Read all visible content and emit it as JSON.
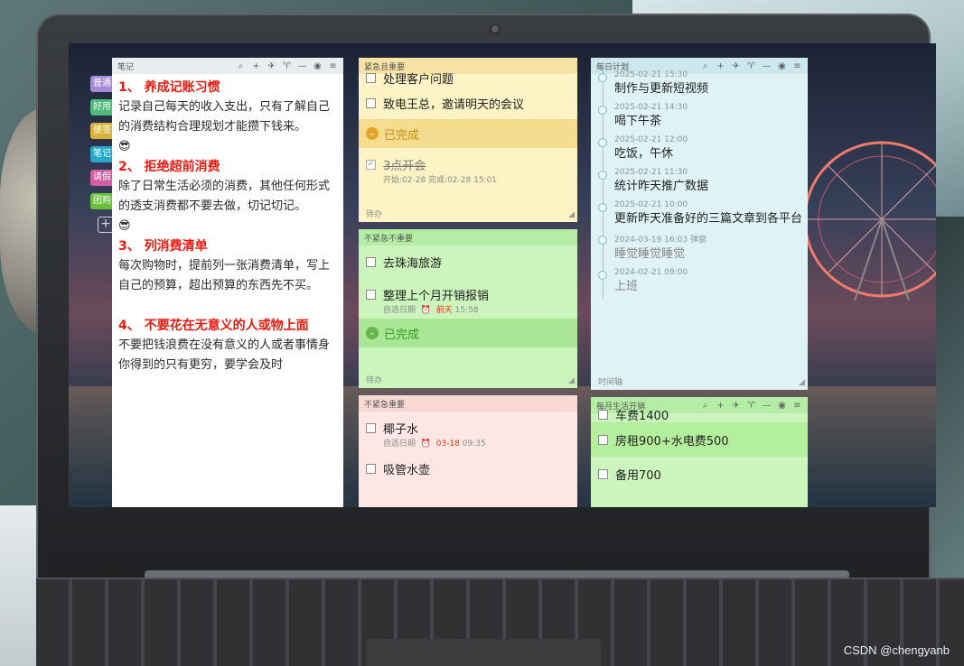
{
  "watermark": "CSDN @chengyanb",
  "side_tabs": [
    {
      "label": "普通",
      "color": "#a58bd9"
    },
    {
      "label": "好用",
      "color": "#4fb87a"
    },
    {
      "label": "便签",
      "color": "#d9b23b"
    },
    {
      "label": "笔记",
      "color": "#2aa7c9"
    },
    {
      "label": "请假",
      "color": "#d15ea3"
    },
    {
      "label": "团购",
      "color": "#6abf3b"
    }
  ],
  "main_note": {
    "title": "笔记",
    "sections": [
      {
        "title": "1、 养成记账习惯",
        "body": "记录自己每天的收入支出，只有了解自己的消费结构合理规划才能攒下钱来。",
        "emoji": "😎"
      },
      {
        "title": "2、 拒绝超前消费",
        "body": "除了日常生活必须的消费，其他任何形式的透支消费都不要去做，切记切记。",
        "emoji": "😎"
      },
      {
        "title": "3、 列消费清单",
        "body": "每次购物时，提前列一张消费清单，写上自己的预算，超出预算的东西先不买。"
      },
      {
        "title": "4、 不要花在无意义的人或物上面",
        "body": "不要把钱浪费在没有意义的人或者事情身你得到的只有更穷，要学会及时"
      }
    ]
  },
  "q1": {
    "title": "紧急且重要",
    "cut_task": "处理客户问题",
    "task": "致电王总，邀请明天的会议",
    "done_label": "已完成",
    "done_task": "3点开会",
    "done_meta": "开始:02-28    完成:02-28 15:01",
    "footer": "待办"
  },
  "q2": {
    "title": "不紧急不重要",
    "tasks": [
      {
        "text": "去珠海旅游"
      },
      {
        "text": "整理上个月开销报销",
        "meta_a": "自选日期",
        "meta_b": "前天",
        "meta_c": "15:58"
      }
    ],
    "done_label": "已完成",
    "footer": "待办"
  },
  "q3": {
    "title": "不紧急重要",
    "tasks": [
      {
        "text": "椰子水",
        "meta_a": "自选日期",
        "meta_b": "03-18",
        "meta_c": "09:35"
      },
      {
        "text": "吸管水壶"
      }
    ]
  },
  "timeline": {
    "title": "每日计划",
    "items": [
      {
        "time": "2025-02-21 15:30",
        "text": "制作与更新短视频"
      },
      {
        "time": "2025-02-21 14:30",
        "text": "喝下午茶"
      },
      {
        "time": "2025-02-21 12:00",
        "text": "吃饭，午休"
      },
      {
        "time": "2025-02-21 11:30",
        "text": "统计昨天推广数据"
      },
      {
        "time": "2025-02-21 10:00",
        "text": "更新昨天准备好的三篇文章到各平台"
      },
      {
        "time": "2024-03-19 16:03  弹窗",
        "text": "睡觉睡觉睡觉",
        "done": true
      },
      {
        "time": "2024-02-21 09:00",
        "text": "上班",
        "done": true
      }
    ],
    "footer": "时间轴"
  },
  "monthly": {
    "title": "每月生活开销",
    "rows": [
      {
        "text": "车费1400"
      },
      {
        "text": "房租900+水电费500"
      },
      {
        "text": "备用700"
      }
    ]
  },
  "toolbar_icons": [
    "search-icon",
    "add-icon",
    "pin-icon",
    "skin-icon",
    "minimize-icon",
    "hide-icon",
    "menu-icon"
  ]
}
